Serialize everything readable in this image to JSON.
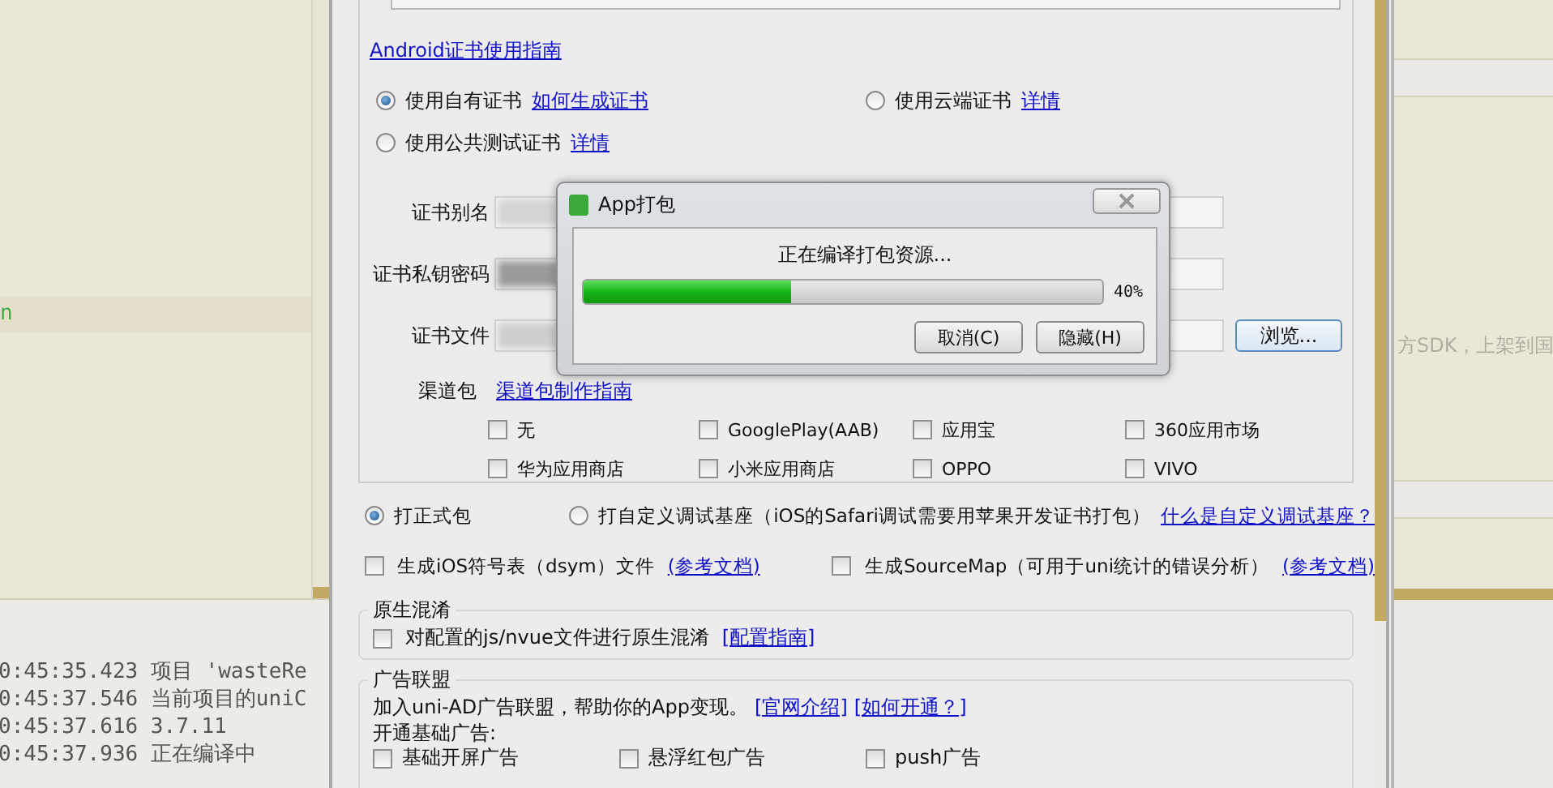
{
  "editor": {
    "code_fragment": "n"
  },
  "console": {
    "lines": [
      {
        "time": "0:45:35.423",
        "message": "项目 'wasteRe"
      },
      {
        "time": "0:45:37.546",
        "message": "当前项目的uniC"
      },
      {
        "time": "0:45:37.616",
        "message": "3.7.11"
      },
      {
        "time": "0:45:37.936",
        "message": "正在编译中"
      }
    ]
  },
  "side_panel": {
    "text": "方SDK，上架到国"
  },
  "pack_dialog": {
    "android_guide_link": "Android证书使用指南",
    "certificate_options": [
      {
        "label": "使用自有证书",
        "link": "如何生成证书",
        "selected": true
      },
      {
        "label": "使用云端证书",
        "link": "详情",
        "selected": false
      },
      {
        "label": "使用公共测试证书",
        "link": "详情",
        "selected": false
      }
    ],
    "fields": [
      {
        "label": "证书别名"
      },
      {
        "label": "证书私钥密码"
      },
      {
        "label": "证书文件",
        "button": "浏览..."
      }
    ],
    "channel": {
      "label": "渠道包",
      "link": "渠道包制作指南",
      "options": [
        {
          "label": "无",
          "checked": false
        },
        {
          "label": "GooglePlay(AAB)",
          "checked": false
        },
        {
          "label": "应用宝",
          "checked": false
        },
        {
          "label": "360应用市场",
          "checked": false
        },
        {
          "label": "华为应用商店",
          "checked": false
        },
        {
          "label": "小米应用商店",
          "checked": false
        },
        {
          "label": "OPPO",
          "checked": false
        },
        {
          "label": "VIVO",
          "checked": false
        }
      ]
    },
    "package_types": [
      {
        "label": "打正式包",
        "selected": true
      },
      {
        "label": "打自定义调试基座（iOS的Safari调试需要用苹果开发证书打包）",
        "link": "什么是自定义调试基座？",
        "selected": false
      }
    ],
    "extras": [
      {
        "label": "生成iOS符号表（dsym）文件",
        "link": "(参考文档)",
        "checked": false
      },
      {
        "label": "生成SourceMap（可用于uni统计的错误分析）",
        "link": "(参考文档)",
        "checked": false
      }
    ],
    "obfuscation": {
      "title": "原生混淆",
      "label": "对配置的js/nvue文件进行原生混淆",
      "checked": false,
      "link": "[配置指南]"
    },
    "ads": {
      "title": "广告联盟",
      "text": "加入uni-AD广告联盟，帮助你的App变现。",
      "links": [
        "[官网介绍]",
        "[如何开通？]"
      ],
      "subtitle": "开通基础广告:",
      "options": [
        {
          "label": "基础开屏广告",
          "checked": false
        },
        {
          "label": "悬浮红包广告",
          "checked": false
        },
        {
          "label": "push广告",
          "checked": false
        }
      ]
    }
  },
  "progress_dialog": {
    "title": "App打包",
    "message": "正在编译打包资源...",
    "level": 0.4,
    "reading": "40%",
    "buttons": [
      "取消(C)",
      "隐藏(H)"
    ]
  }
}
